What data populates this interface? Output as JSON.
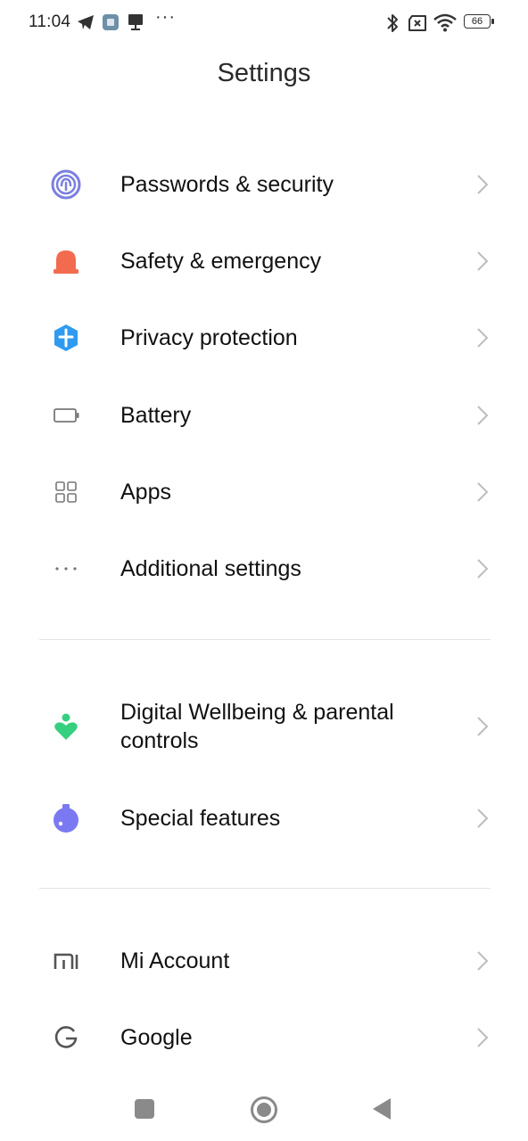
{
  "status_bar": {
    "time": "11:04",
    "overflow": "···",
    "battery_level": "66",
    "icons": [
      "telegram-icon",
      "app-notification-icon",
      "usb-debug-icon",
      "bluetooth-icon",
      "no-sim-icon",
      "wifi-icon",
      "battery-icon"
    ]
  },
  "header": {
    "title": "Settings"
  },
  "settings": {
    "items": [
      {
        "label": "Passwords & security",
        "icon": "fingerprint-icon",
        "color": "#7A7FE0"
      },
      {
        "label": "Safety & emergency",
        "icon": "siren-icon",
        "color": "#F26B4F"
      },
      {
        "label": "Privacy protection",
        "icon": "privacy-shield-icon",
        "color": "#2E9BF0"
      },
      {
        "label": "Battery",
        "icon": "battery-icon",
        "color": "#777777"
      },
      {
        "label": "Apps",
        "icon": "apps-grid-icon",
        "color": "#777777"
      },
      {
        "label": "Additional settings",
        "icon": "more-dots-icon",
        "color": "#777777"
      },
      {
        "label": "Digital Wellbeing & parental controls",
        "icon": "wellbeing-icon",
        "color": "#35D07F"
      },
      {
        "label": "Special features",
        "icon": "special-features-icon",
        "color": "#7B79F2"
      },
      {
        "label": "Mi Account",
        "icon": "mi-logo-icon",
        "color": "#555555"
      },
      {
        "label": "Google",
        "icon": "google-icon",
        "color": "#555555"
      }
    ]
  },
  "navigation_bar": {
    "buttons": [
      "recents-button",
      "home-button",
      "back-button"
    ]
  }
}
